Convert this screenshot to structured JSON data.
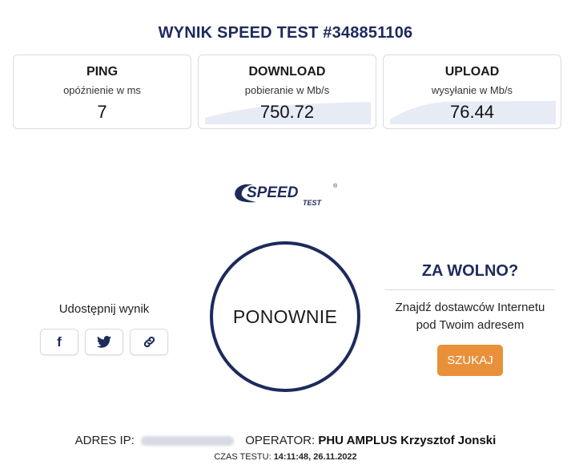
{
  "title": "WYNIK SPEED TEST #348851106",
  "metrics": {
    "ping": {
      "label": "PING",
      "sub": "opóźnienie w ms",
      "value": "7"
    },
    "download": {
      "label": "DOWNLOAD",
      "sub": "pobieranie w Mb/s",
      "value": "750.72"
    },
    "upload": {
      "label": "UPLOAD",
      "sub": "wysyłanie w Mb/s",
      "value": "76.44"
    }
  },
  "logo": {
    "main": "SPEED",
    "sub": "TEST",
    "mark": "®"
  },
  "share": {
    "label": "Udostępnij wynik",
    "facebook_icon": "f"
  },
  "again_label": "PONOWNIE",
  "slow": {
    "title": "ZA WOLNO?",
    "text": "Znajdź dostawców Internetu pod Twoim adresem",
    "button": "SZUKAJ"
  },
  "footer": {
    "ip_label": "ADRES IP:",
    "operator_label": "OPERATOR:",
    "operator_value": "PHU AMPLUS Krzysztof Jonski",
    "time_label": "CZAS TESTU:",
    "time_value": "14:11:48, 26.11.2022"
  },
  "colors": {
    "brand_navy": "#1d2a5c",
    "accent_orange": "#e8913a",
    "wave_fill": "#e7ebf6"
  }
}
